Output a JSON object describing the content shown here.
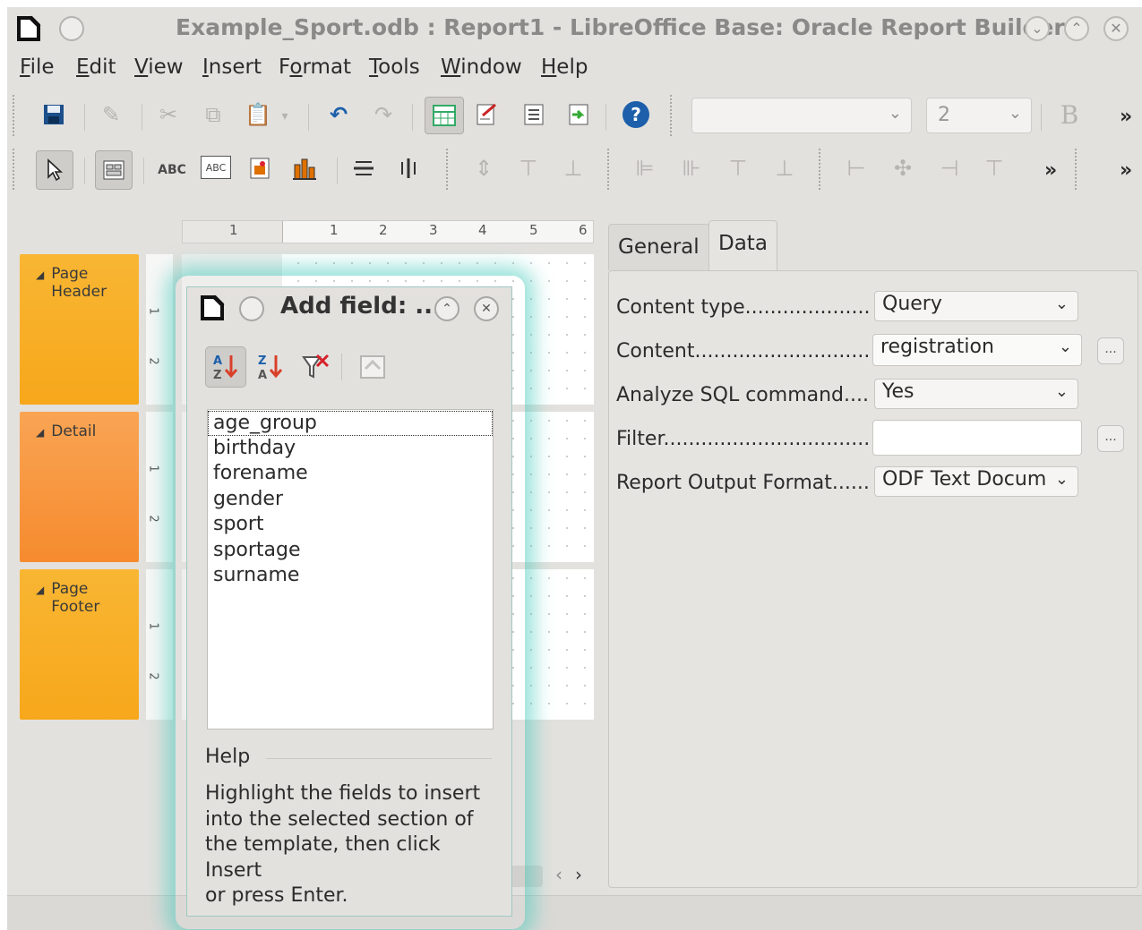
{
  "window": {
    "title": "Example_Sport.odb : Report1 - LibreOffice Base: Oracle Report Builder"
  },
  "menu": {
    "items": [
      {
        "label": "File",
        "mnemonic": "F",
        "rest": "ile"
      },
      {
        "label": "Edit",
        "mnemonic": "E",
        "rest": "dit"
      },
      {
        "label": "View",
        "mnemonic": "V",
        "rest": "iew"
      },
      {
        "label": "Insert",
        "mnemonic": "I",
        "rest": "nsert"
      },
      {
        "label": "Format",
        "pre": "F",
        "mnemonic": "o",
        "rest": "rmat"
      },
      {
        "label": "Tools",
        "mnemonic": "T",
        "rest": "ools"
      },
      {
        "label": "Window",
        "mnemonic": "W",
        "rest": "indow"
      },
      {
        "label": "Help",
        "mnemonic": "H",
        "rest": "elp"
      }
    ]
  },
  "toolbar": {
    "font_name_value": "",
    "font_size_value": "2",
    "bold_label": "B",
    "more": "»",
    "label_text_icon": "ABC",
    "label_field_icon": "ABC"
  },
  "design": {
    "ruler_numbers": [
      "1",
      "1",
      "2",
      "3",
      "4",
      "5",
      "6"
    ],
    "sections": [
      {
        "line1": "Page",
        "line2": "Header"
      },
      {
        "line1": "Detail",
        "line2": ""
      },
      {
        "line1": "Page",
        "line2": "Footer"
      }
    ],
    "vruler_marks": [
      "1",
      "2"
    ]
  },
  "panel": {
    "tabs": [
      "General",
      "Data"
    ],
    "active_tab": "Data",
    "properties": [
      {
        "label": "Content type",
        "dots": ".........................",
        "value": "Query"
      },
      {
        "label": "Content",
        "dots": "....................................",
        "value": "registration"
      },
      {
        "label": "Analyze SQL command",
        "dots": ".....",
        "value": "Yes"
      },
      {
        "label": "Filter",
        "dots": "..........................................",
        "value": ""
      },
      {
        "label": "Report Output Format",
        "dots": ".......",
        "value": "ODF Text Docum"
      }
    ]
  },
  "dialog": {
    "title": "Add field: ...",
    "fields": [
      "age_group",
      "birthday",
      "forename",
      "gender",
      "sport",
      "sportage",
      "surname"
    ],
    "help_heading": "Help",
    "help_lines": [
      "Highlight the fields to insert",
      "into the selected section of",
      "the template, then click Insert",
      "or press Enter."
    ]
  },
  "icons": {
    "title_logo": "document-icon",
    "accent": "#1d5faa",
    "chart_color": "#e07000"
  }
}
